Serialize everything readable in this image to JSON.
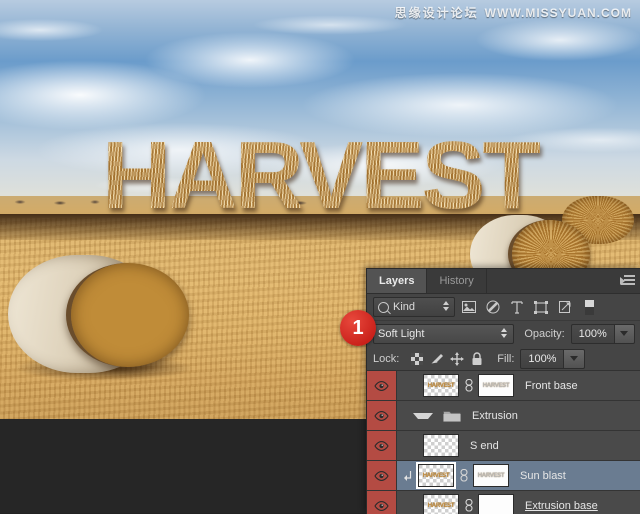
{
  "watermark": {
    "chinese": "思缘设计论坛",
    "url": "WWW.MISSYUAN.COM"
  },
  "artwork": {
    "headline_text": "HARVEST",
    "description": "Photo of a harvested wheat field with round hay bales and the word HARVEST formed out of straw"
  },
  "annotation": {
    "step_number": "1"
  },
  "panel": {
    "tabs": [
      {
        "label": "Layers",
        "active": true
      },
      {
        "label": "History",
        "active": false
      }
    ],
    "menu_icon": "panel-menu-icon",
    "filter": {
      "kind_label": "Kind",
      "search_icon": "search-icon",
      "icons": [
        {
          "name": "filter-pixel-icon",
          "title": "Pixel layers"
        },
        {
          "name": "filter-adjustment-icon",
          "title": "Adjustment layers"
        },
        {
          "name": "filter-type-icon",
          "title": "Type layers"
        },
        {
          "name": "filter-shape-icon",
          "title": "Shape layers"
        },
        {
          "name": "filter-smart-object-icon",
          "title": "Smart objects"
        },
        {
          "name": "filter-toggle-icon",
          "title": "Filter toggle"
        }
      ]
    },
    "blend_mode": "Soft Light",
    "opacity_label": "Opacity:",
    "opacity_value": "100%",
    "lock_label": "Lock:",
    "lock_icons": [
      {
        "name": "lock-transparent-pixels-icon"
      },
      {
        "name": "lock-image-pixels-icon"
      },
      {
        "name": "lock-position-icon"
      },
      {
        "name": "lock-all-icon"
      }
    ],
    "fill_label": "Fill:",
    "fill_value": "100%",
    "layers": [
      {
        "name": "Front base",
        "visible": true,
        "selected": false,
        "type": "layer",
        "has_mask": true,
        "clipped": false,
        "thumb_text": "HARVEST",
        "mask_text": "HARVEST",
        "indent": 0,
        "editing": false
      },
      {
        "name": "Extrusion",
        "visible": true,
        "selected": false,
        "type": "group",
        "expanded": true,
        "has_mask": false,
        "clipped": false,
        "indent": 0,
        "editing": false
      },
      {
        "name": "S end",
        "visible": true,
        "selected": false,
        "type": "layer",
        "has_mask": false,
        "clipped": false,
        "thumb_text": "",
        "indent": 1,
        "editing": false
      },
      {
        "name": "Sun blast",
        "visible": true,
        "selected": true,
        "type": "layer",
        "has_mask": true,
        "clipped": true,
        "thumb_text": "HARVEST",
        "mask_text": "HARVEST",
        "indent": 1,
        "editing": false
      },
      {
        "name": "Extrusion base ",
        "visible": true,
        "selected": false,
        "type": "layer",
        "has_mask": true,
        "clipped": false,
        "thumb_text": "HARVEST",
        "mask_text": "",
        "indent": 1,
        "editing": true
      }
    ]
  },
  "colors": {
    "panel_bg": "#454545",
    "layer_row_bg": "#4a4a4a",
    "layer_row_selected": "#6a7c91",
    "eye_cell_highlight": "#b44b43",
    "badge_red": "#c9201a",
    "text": "#e6e6e6"
  }
}
